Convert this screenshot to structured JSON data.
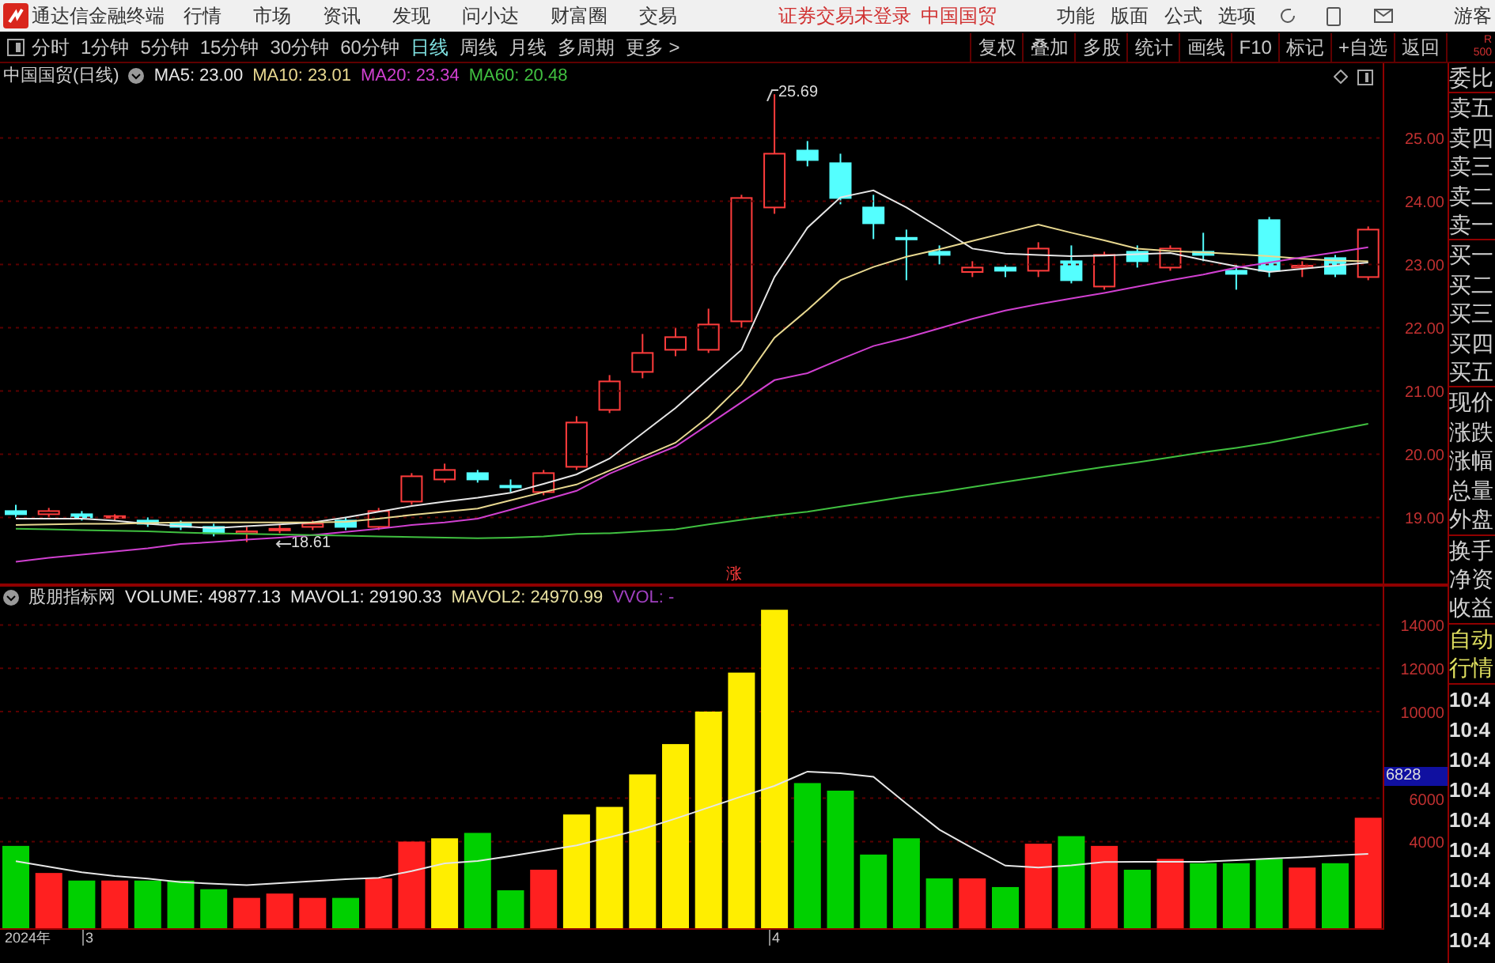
{
  "menu_bar": {
    "app_title": "通达信金融终端",
    "menus": [
      "行情",
      "市场",
      "资讯",
      "发现",
      "问小达",
      "财富圈",
      "交易"
    ],
    "status_texts": [
      "证券交易未登录",
      "中国国贸"
    ],
    "right_menus": [
      "功能",
      "版面",
      "公式",
      "选项"
    ],
    "user": "游客"
  },
  "toolbar": {
    "periods": [
      {
        "label": "分时",
        "selected": false
      },
      {
        "label": "1分钟",
        "selected": false
      },
      {
        "label": "5分钟",
        "selected": false
      },
      {
        "label": "15分钟",
        "selected": false
      },
      {
        "label": "30分钟",
        "selected": false
      },
      {
        "label": "60分钟",
        "selected": false
      },
      {
        "label": "日线",
        "selected": true
      },
      {
        "label": "周线",
        "selected": false
      },
      {
        "label": "月线",
        "selected": false
      },
      {
        "label": "多周期",
        "selected": false
      },
      {
        "label": "更多 >",
        "selected": false
      }
    ],
    "actions": [
      "复权",
      "叠加",
      "多股",
      "统计",
      "画线",
      "F10",
      "标记",
      "+自选",
      "返回"
    ],
    "corner_text": [
      "R",
      "500"
    ]
  },
  "price_chart": {
    "title": "中国国贸(日线)",
    "legend_separator": ": ",
    "readings": [
      "23.00",
      "23.01",
      "23.34",
      "20.48"
    ],
    "chart_data": {
      "type": "line",
      "grid": true,
      "ylim": [
        17.93,
        26.18
      ],
      "yticks": [
        {
          "value": 25,
          "label": "25.00"
        },
        {
          "value": 24,
          "label": "24.00"
        },
        {
          "value": 23,
          "label": "23.00"
        },
        {
          "value": 22,
          "label": "22.00"
        },
        {
          "value": 21,
          "label": "21.00"
        },
        {
          "value": 20,
          "label": "20.00"
        },
        {
          "value": 19,
          "label": "19.00"
        }
      ],
      "series": [
        {
          "name": "MA5",
          "color": "#e6e6e6",
          "values": [
            18.98,
            18.98,
            18.98,
            18.95,
            18.9,
            18.86,
            18.83,
            18.86,
            18.89,
            18.92,
            19.0,
            19.09,
            19.18,
            19.25,
            19.31,
            19.39,
            19.53,
            19.68,
            19.93,
            20.33,
            20.73,
            21.19,
            21.65,
            22.8,
            23.58,
            24.06,
            24.17,
            23.9,
            23.58,
            23.25,
            23.17,
            23.15,
            23.13,
            23.14,
            23.16,
            23.18,
            23.07,
            22.97,
            22.88,
            22.93,
            22.98,
            23.03
          ]
        },
        {
          "name": "MA10",
          "color": "#e8d890",
          "values": [
            18.88,
            18.89,
            18.9,
            18.9,
            18.91,
            18.92,
            18.92,
            18.92,
            18.92,
            18.92,
            18.93,
            18.98,
            19.04,
            19.09,
            19.14,
            19.27,
            19.4,
            19.52,
            19.74,
            19.96,
            20.18,
            20.59,
            21.1,
            21.84,
            22.28,
            22.75,
            22.96,
            23.12,
            23.24,
            23.37,
            23.5,
            23.63,
            23.5,
            23.38,
            23.25,
            23.21,
            23.19,
            23.16,
            23.13,
            23.09,
            23.06,
            23.05
          ]
        },
        {
          "name": "MA20",
          "color": "#d040d0",
          "values": [
            18.3,
            18.36,
            18.41,
            18.46,
            18.51,
            18.58,
            18.61,
            18.65,
            18.68,
            18.72,
            18.77,
            18.82,
            18.88,
            18.92,
            18.98,
            19.12,
            19.27,
            19.42,
            19.69,
            19.91,
            20.12,
            20.47,
            20.82,
            21.17,
            21.28,
            21.5,
            21.71,
            21.84,
            21.99,
            22.14,
            22.27,
            22.37,
            22.46,
            22.55,
            22.65,
            22.75,
            22.84,
            22.95,
            23.03,
            23.11,
            23.19,
            23.27
          ]
        },
        {
          "name": "MA60",
          "color": "#40c040",
          "values": [
            18.82,
            18.81,
            18.8,
            18.79,
            18.78,
            18.76,
            18.75,
            18.74,
            18.73,
            18.72,
            18.71,
            18.7,
            18.69,
            18.68,
            18.67,
            18.68,
            18.7,
            18.74,
            18.75,
            18.78,
            18.81,
            18.89,
            18.96,
            19.03,
            19.09,
            19.17,
            19.25,
            19.33,
            19.4,
            19.48,
            19.56,
            19.64,
            19.72,
            19.8,
            19.87,
            19.95,
            20.03,
            20.1,
            20.18,
            20.28,
            20.38,
            20.48
          ]
        }
      ]
    },
    "high_label": "25.69",
    "low_label": "18.61",
    "marker": "涨"
  },
  "volume_chart": {
    "title": "股朋指标网",
    "indicators": [
      {
        "label": "VOLUME: 49877.13",
        "color": "#e6e6e6"
      },
      {
        "label": "MAVOL2: 24970.99",
        "color": "#e8e0a0"
      },
      {
        "label": "VVOL: -",
        "color": "#a040c0"
      }
    ],
    "readings": [
      "29190.33"
    ],
    "current_value": "6828",
    "chart_data": {
      "type": "bar",
      "stacked": true,
      "grid": true,
      "ylim": [
        0,
        15840
      ],
      "yticks": [
        {
          "value": 14000,
          "label": "14000"
        },
        {
          "value": 12000,
          "label": "12000"
        },
        {
          "value": 10000,
          "label": "10000"
        },
        {
          "value": 6000,
          "label": "6000"
        },
        {
          "value": 4000,
          "label": "4000"
        }
      ],
      "series": [
        {
          "color": "#ff2020",
          "values": [
            null,
            2550,
            null,
            2200,
            null,
            null,
            null,
            1400,
            1600,
            1400,
            null,
            2300,
            4000,
            null,
            null,
            null,
            2700,
            null,
            null,
            null,
            null,
            null,
            null,
            null,
            null,
            null,
            null,
            null,
            null,
            2300,
            null,
            3900,
            null,
            3800,
            null,
            3200,
            null,
            null,
            null,
            2800,
            null,
            5100
          ]
        },
        {
          "color": "#00d000",
          "values": [
            3800,
            null,
            2200,
            null,
            2200,
            2200,
            1800,
            null,
            null,
            null,
            1400,
            null,
            null,
            null,
            4400,
            1750,
            null,
            null,
            null,
            null,
            null,
            null,
            null,
            null,
            6700,
            6350,
            3400,
            4150,
            2300,
            null,
            1900,
            null,
            4250,
            null,
            2700,
            null,
            3000,
            3000,
            3200,
            null,
            3000,
            null
          ]
        },
        {
          "color": "#ffee00",
          "values": [
            null,
            null,
            null,
            null,
            null,
            null,
            null,
            null,
            null,
            null,
            null,
            null,
            null,
            4150,
            null,
            null,
            null,
            5250,
            5600,
            7100,
            8500,
            10000,
            11800,
            14700,
            null,
            null,
            null,
            null,
            null,
            null,
            null,
            null,
            null,
            null,
            null,
            null,
            null,
            null,
            null,
            null,
            null,
            null
          ]
        },
        {
          "name": "MAVOL1",
          "type": "line",
          "color": "#e6e6e6",
          "values": [
            3090,
            2840,
            2580,
            2410,
            2290,
            2130,
            2050,
            1990,
            2080,
            2170,
            2260,
            2330,
            2640,
            2990,
            3100,
            3330,
            3580,
            3820,
            4200,
            4580,
            5060,
            5570,
            6080,
            6570,
            7230,
            7150,
            6990,
            5750,
            4550,
            3700,
            2890,
            2800,
            2900,
            3060,
            3070,
            3070,
            3070,
            3140,
            3210,
            3280,
            3360,
            3430
          ]
        }
      ]
    }
  },
  "quote_panel": {
    "groups": [
      [
        "委比"
      ],
      [
        "卖五",
        "卖四",
        "卖三",
        "卖二",
        "卖一"
      ],
      [
        "买一",
        "买二",
        "买三",
        "买四",
        "买五"
      ],
      [
        "现价",
        "涨跌",
        "涨幅",
        "总量",
        "外盘"
      ],
      [
        "换手",
        "净资",
        "收益"
      ],
      [
        "自动",
        "行情"
      ]
    ],
    "time_labels": [
      "10:4",
      "10:4",
      "10:4",
      "10:4",
      "10:4",
      "10:4",
      "10:4",
      "10:4",
      "10:4"
    ]
  },
  "date_axis": {
    "labels": [
      "2024年",
      "3",
      "4"
    ]
  }
}
